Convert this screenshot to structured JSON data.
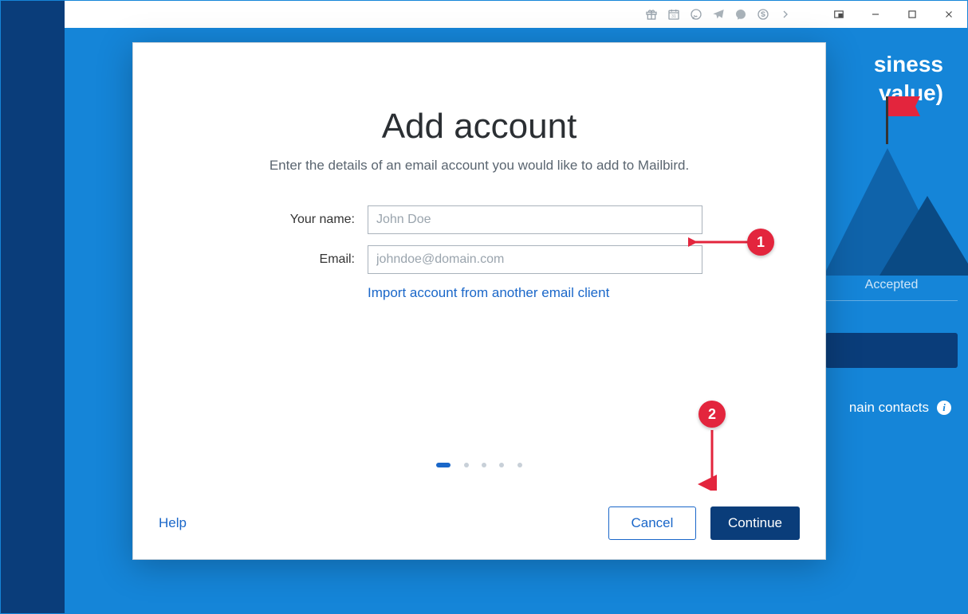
{
  "titlebar": {
    "icons": [
      "gift-icon",
      "calendar-icon",
      "whatsapp-icon",
      "telegram-icon",
      "messenger-icon",
      "skype-icon",
      "more-icon"
    ],
    "window": {
      "play": "play-icon",
      "min": "minimize",
      "max": "maximize",
      "close": "close"
    }
  },
  "promo": {
    "line_suffix_1": "siness",
    "line_suffix_2": " value)"
  },
  "right": {
    "accepted_label": "Accepted",
    "domain_contacts_suffix": "nain contacts"
  },
  "modal": {
    "title": "Add account",
    "subtitle": "Enter the details of an email account you would like to add to Mailbird.",
    "name_label": "Your name:",
    "name_placeholder": "John Doe",
    "email_label": "Email:",
    "email_placeholder": "johndoe@domain.com",
    "import_link": "Import account from another email client",
    "help": "Help",
    "cancel": "Cancel",
    "continue": "Continue",
    "pager_total": 5,
    "pager_active": 1
  },
  "annotations": {
    "callout1": "1",
    "callout2": "2"
  }
}
